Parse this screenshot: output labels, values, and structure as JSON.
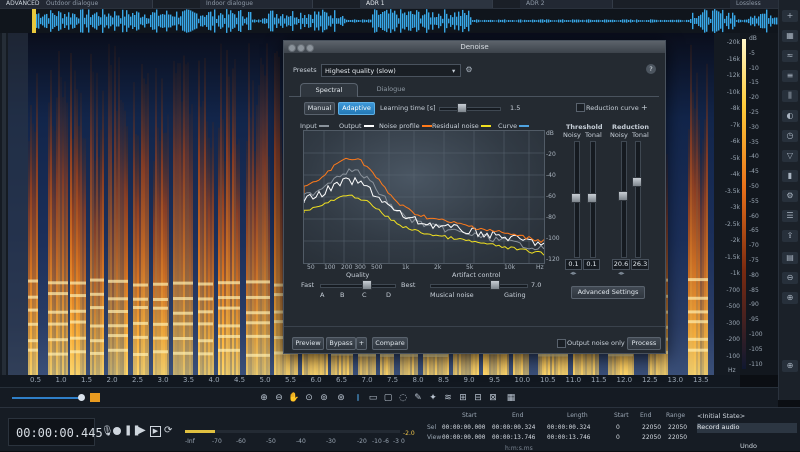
{
  "file_tabs": [
    "ADVANCED",
    "Outdoor dialogue",
    "Indoor dialogue",
    "ADR 1",
    "ADR 2",
    "Lossless"
  ],
  "time_ruler": {
    "ticks": [
      "0.5",
      "1.0",
      "1.5",
      "2.0",
      "2.5",
      "3.0",
      "3.5",
      "4.0",
      "4.5",
      "5.0",
      "5.5",
      "6.0",
      "6.5",
      "7.0",
      "7.5",
      "8.0",
      "8.5",
      "9.0",
      "9.5",
      "10.0",
      "10.5",
      "11.0",
      "11.5",
      "12.0",
      "12.5",
      "13.0",
      "13.5"
    ],
    "unit": "s"
  },
  "freq_axis": {
    "labels": [
      "-20k",
      "-16k",
      "-12k",
      "-10k",
      "-8k",
      "-7k",
      "-6k",
      "-5k",
      "-4k",
      "-3.5k",
      "-3k",
      "-2.5k",
      "-2k",
      "-1.5k",
      "-1k",
      "-700",
      "-500",
      "-300",
      "-200",
      "-100"
    ],
    "unit": "Hz"
  },
  "db_axis": {
    "labels": [
      "dB",
      "-5",
      "-10",
      "-15",
      "-20",
      "-25",
      "-30",
      "-35",
      "-40",
      "-45",
      "-50",
      "-55",
      "-60",
      "-65",
      "-70",
      "-75",
      "-80",
      "-85",
      "-90",
      "-95",
      "-100",
      "-105",
      "-110"
    ]
  },
  "transport": {
    "timecode": "00:00:00.445",
    "meter_labels": [
      "-Inf",
      "-70",
      "-60",
      "-50",
      "-40",
      "-30",
      "-20",
      "-10",
      "-6",
      "-3",
      "0"
    ],
    "meter_peak": "-2.0"
  },
  "selection": {
    "headers": [
      "Start",
      "End",
      "Length"
    ],
    "row_labels": [
      "Sel",
      "View"
    ],
    "sel": [
      "00:00:00.000",
      "00:00:00.324",
      "00:00:00.324"
    ],
    "view": [
      "00:00:00.000",
      "00:00:13.746",
      "00:00:13.746"
    ],
    "format": "h:m:s.ms",
    "freq_headers": [
      "Start",
      "End",
      "Range"
    ],
    "freq_sel": [
      "0",
      "22050",
      "22050"
    ],
    "freq_view": [
      "0",
      "22050",
      "22050"
    ]
  },
  "history": {
    "items": [
      "<Initial State>",
      "Record audio"
    ],
    "undo_label": "Undo"
  },
  "denoise": {
    "title": "Denoise",
    "presets_label": "Presets",
    "preset_value": "Highest quality (slow)",
    "help": "?",
    "tabs": [
      "Spectral",
      "Dialogue"
    ],
    "mode_manual": "Manual",
    "mode_adaptive": "Adaptive",
    "learning_label": "Learning time [s]",
    "learning_value": "1.5",
    "learning_level": 0.3,
    "reduction_curve_label": "Reduction curve",
    "legend": [
      "Input",
      "Output",
      "Noise profile",
      "Residual noise",
      "Curve"
    ],
    "legend_colors": [
      "#8a929b",
      "#ffffff",
      "#ff7a1a",
      "#f0e020",
      "#4fa3e0"
    ],
    "graph_db": [
      "dB",
      "-20",
      "-40",
      "-60",
      "-80",
      "-100",
      "-120"
    ],
    "graph_hz": [
      "50",
      "100",
      "200 300",
      "500",
      "1k",
      "2k",
      "5k",
      "10k",
      "Hz"
    ],
    "threshold": {
      "label": "Threshold",
      "noisy": "Noisy",
      "tonal": "Tonal",
      "noisy_val": "0.1",
      "tonal_val": "0.1"
    },
    "reduction": {
      "label": "Reduction",
      "noisy": "Noisy",
      "tonal": "Tonal",
      "noisy_val": "20.6",
      "tonal_val": "26.3"
    },
    "quality_label": "Quality",
    "quality_fast": "Fast",
    "quality_best": "Best",
    "quality_options": [
      "A",
      "B",
      "C",
      "D"
    ],
    "quality_value": "C",
    "artifact_label": "Artifact control",
    "artifact_musical": "Musical noise",
    "artifact_gating": "Gating",
    "artifact_value": "7.0",
    "advanced_button": "Advanced Settings",
    "preview_button": "Preview",
    "bypass_button": "Bypass",
    "plus": "+",
    "compare_button": "Compare",
    "output_noise_label": "Output noise only",
    "process_button": "Process"
  }
}
